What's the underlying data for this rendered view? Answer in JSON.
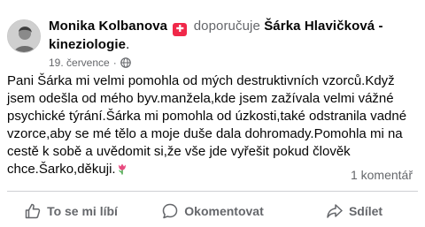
{
  "post": {
    "author": "Monika Kolbanova",
    "verb": "doporučuje",
    "target": "Šárka Hlavičková - kineziologie",
    "target_suffix": ".",
    "date": "19. července",
    "date_sep": "·",
    "body_text": "Pani Šárka mi velmi pomohla od mých destruktivních vzorců.Když jsem odešla od mého byv.manžela,kde jsem zažívala velmi vážné psychické týrání.Šárka mi pomohla od úzkosti,také odstranila vadné vzorce,aby se mé tělo a moje duše dala dohromady.Pomohla mi na cestě k sobě a uvědomit si,že vše jde vyřešit pokud člověk chce.Šarko,děkuji.",
    "comment_count": "1 komentář"
  },
  "icons": {
    "recommend": "recommend-icon",
    "privacy": "globe-icon",
    "emoji": "tulip-icon",
    "like": "thumbs-up-icon",
    "comment": "comment-icon",
    "share": "share-icon"
  },
  "colors": {
    "recommend_red": "#f02849",
    "secondary_text": "#65676b",
    "divider": "#ced0d4"
  },
  "actions": {
    "like_label": "To se mi líbí",
    "comment_label": "Okomentovat",
    "share_label": "Sdílet"
  }
}
